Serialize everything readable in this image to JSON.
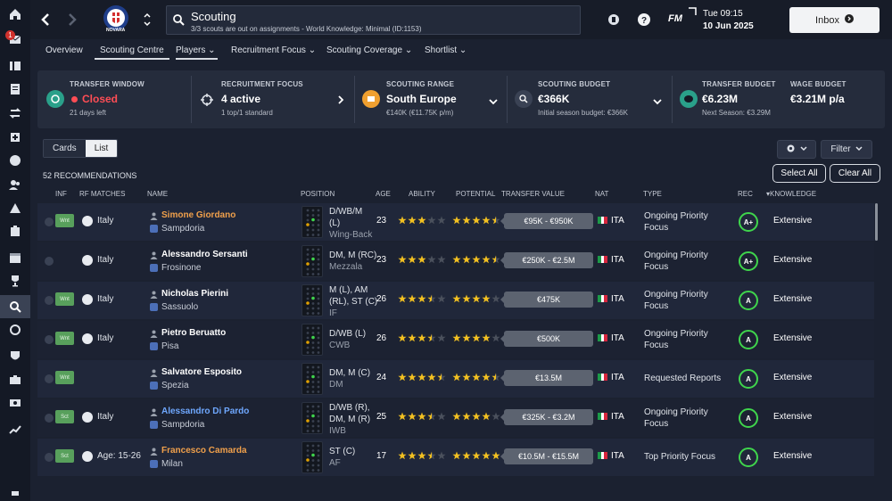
{
  "sidebar": {
    "badge_count": "1"
  },
  "header": {
    "title": "Scouting",
    "subtitle": "3/3 scouts are out on assignments - World Knowledge: Minimal (ID:1153)",
    "club_badge_text": "NOVARA",
    "fm_label": "FM",
    "day_time": "Tue 09:15",
    "date": "10 Jun 2025",
    "inbox_label": "Inbox"
  },
  "tabs": [
    {
      "label": "Overview"
    },
    {
      "label": "Scouting Centre"
    },
    {
      "label": "Players ⌄"
    },
    {
      "label": "Recruitment Focus ⌄"
    },
    {
      "label": "Scouting Coverage ⌄"
    },
    {
      "label": "Shortlist ⌄"
    }
  ],
  "summary": {
    "transfer_window": {
      "label": "TRANSFER WINDOW",
      "value": "Closed",
      "sub": "21 days left"
    },
    "recruitment_focus": {
      "label": "RECRUITMENT FOCUS",
      "value": "4 active",
      "sub": "1 top/1 standard"
    },
    "scouting_range": {
      "label": "SCOUTING RANGE",
      "value": "South Europe",
      "sub": "€140K (€11.75K p/m)"
    },
    "scouting_budget": {
      "label": "SCOUTING BUDGET",
      "value": "€366K",
      "sub": "Initial season budget: €366K"
    },
    "transfer_budget": {
      "label": "TRANSFER BUDGET",
      "value": "€6.23M",
      "sub": "Next Season: €3.29M"
    },
    "wage_budget": {
      "label": "WAGE BUDGET",
      "value": "€3.21M p/a"
    }
  },
  "view_toggle": {
    "cards": "Cards",
    "list": "List"
  },
  "filter_label": "Filter",
  "select_all": "Select All",
  "clear_all": "Clear All",
  "recommendations_count": "52 RECOMMENDATIONS",
  "columns": {
    "inf": "INF",
    "rf": "RF MATCHES",
    "name": "NAME",
    "position": "POSITION",
    "age": "AGE",
    "ability": "ABILITY",
    "potential": "POTENTIAL",
    "value": "TRANSFER VALUE",
    "nat": "NAT",
    "type": "TYPE",
    "rec": "REC",
    "knowledge": "▾KNOWLEDGE"
  },
  "colors": {
    "accent_green": "#3fd54c",
    "wanted_tag": "#58a05c",
    "name_orange": "#f0a04b",
    "name_blue": "#6fa8ff",
    "star_gold": "#f2c021"
  },
  "rows": [
    {
      "tag": "Wnt",
      "rf": "Italy",
      "name": "Simone Giordano",
      "name_color": "orange",
      "club": "Sampdoria",
      "pos1": "D/WB/M",
      "pos2": "(L)",
      "pos3": "Wing-Back",
      "age": "23",
      "ability": 3,
      "potential": 4.5,
      "value": "€95K - €950K",
      "nat": "ITA",
      "type1": "Ongoing Priority",
      "type2": "Focus",
      "rec": "A+",
      "knowledge": "Extensive"
    },
    {
      "tag": "",
      "rf": "Italy",
      "name": "Alessandro Sersanti",
      "name_color": "white",
      "club": "Frosinone",
      "pos1": "DM, M (RC)",
      "pos2": "Mezzala",
      "pos3": "",
      "age": "23",
      "ability": 3,
      "potential": 4.5,
      "value": "€250K - €2.5M",
      "nat": "ITA",
      "type1": "Ongoing Priority",
      "type2": "Focus",
      "rec": "A+",
      "knowledge": "Extensive"
    },
    {
      "tag": "Wnt",
      "rf": "Italy",
      "name": "Nicholas Pierini",
      "name_color": "white",
      "club": "Sassuolo",
      "pos1": "M (L), AM",
      "pos2": "(RL), ST (C)",
      "pos3": "IF",
      "age": "26",
      "ability": 3.5,
      "potential": 4,
      "value": "€475K",
      "nat": "ITA",
      "type1": "Ongoing Priority",
      "type2": "Focus",
      "rec": "A",
      "knowledge": "Extensive"
    },
    {
      "tag": "Wnt",
      "rf": "Italy",
      "name": "Pietro Beruatto",
      "name_color": "white",
      "club": "Pisa",
      "pos1": "D/WB (L)",
      "pos2": "CWB",
      "pos3": "",
      "age": "26",
      "ability": 3.5,
      "potential": 4,
      "value": "€500K",
      "nat": "ITA",
      "type1": "Ongoing Priority",
      "type2": "Focus",
      "rec": "A",
      "knowledge": "Extensive"
    },
    {
      "tag": "Wnt",
      "rf": "",
      "name": "Salvatore Esposito",
      "name_color": "white",
      "club": "Spezia",
      "pos1": "DM, M (C)",
      "pos2": "DM",
      "pos3": "",
      "age": "24",
      "ability": 4.5,
      "potential": 4.5,
      "value": "€13.5M",
      "nat": "ITA",
      "type1": "Requested Reports",
      "type2": "",
      "rec": "A",
      "knowledge": "Extensive"
    },
    {
      "tag": "Sct",
      "rf": "Italy",
      "name": "Alessandro Di Pardo",
      "name_color": "blue",
      "club": "Sampdoria",
      "pos1": "D/WB (R),",
      "pos2": "DM, M (R)",
      "pos3": "IWB",
      "age": "25",
      "ability": 3.5,
      "potential": 4,
      "value": "€325K - €3.2M",
      "nat": "ITA",
      "type1": "Ongoing Priority",
      "type2": "Focus",
      "rec": "A",
      "knowledge": "Extensive"
    },
    {
      "tag": "Sct",
      "rf": "Age: 15-26",
      "name": "Francesco Camarda",
      "name_color": "orange",
      "club": "Milan",
      "pos1": "ST (C)",
      "pos2": "AF",
      "pos3": "",
      "age": "17",
      "ability": 3.5,
      "potential": 5,
      "value": "€10.5M - €15.5M",
      "nat": "ITA",
      "type1": "Top Priority Focus",
      "type2": "",
      "rec": "A",
      "knowledge": "Extensive"
    }
  ]
}
